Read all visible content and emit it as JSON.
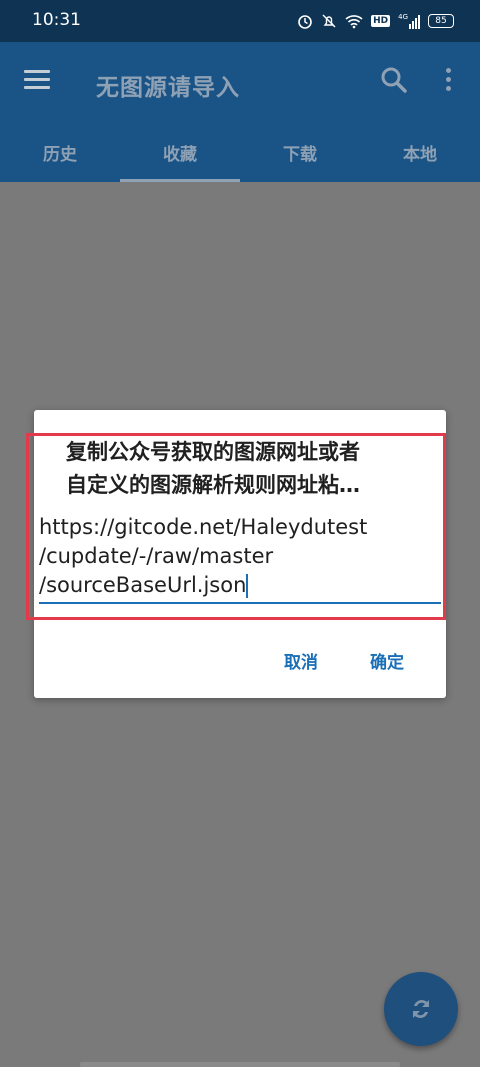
{
  "status_bar": {
    "time": "10:31",
    "hd_label": "HD",
    "network_label": "4G",
    "battery": "85",
    "icons": [
      "alarm-icon",
      "mute-icon",
      "wifi-icon",
      "hd-icon",
      "signal-icon",
      "battery-icon"
    ]
  },
  "app_bar": {
    "title": "无图源请导入",
    "menu_icon": "menu-icon",
    "search_icon": "search-icon",
    "more_icon": "more-vert-icon"
  },
  "tabs": [
    {
      "label": "历史"
    },
    {
      "label": "收藏"
    },
    {
      "label": "下载"
    },
    {
      "label": "本地"
    }
  ],
  "active_tab": "收藏",
  "dialog": {
    "title_line1": "复制公众号获取的图源网址或者",
    "title_line2": "自定义的图源解析规则网址粘…",
    "input_line1": "https://gitcode.net/Haleydutest",
    "input_line2": "/cupdate/-/raw/master",
    "input_line3": "/sourceBaseUrl.json",
    "cancel_label": "取消",
    "ok_label": "确定"
  },
  "fab": {
    "icon": "sync-icon"
  },
  "colors": {
    "accent": "#1a6fb7",
    "appbar": "#1a5486",
    "statusbar": "#0f3352",
    "highlight": "#e23a4a"
  }
}
